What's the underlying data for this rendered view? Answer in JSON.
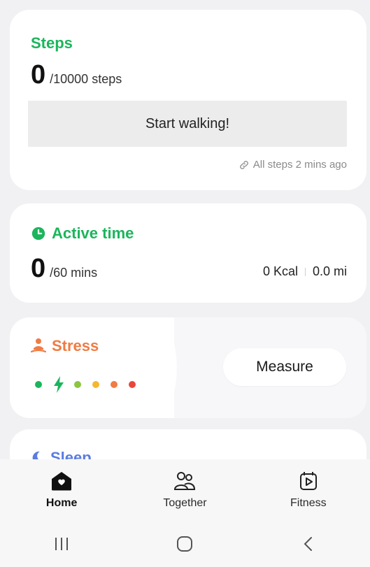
{
  "steps": {
    "title": "Steps",
    "value": "0",
    "goal": "/10000 steps",
    "button_label": "Start walking!",
    "synced_text": "All steps 2 mins ago"
  },
  "active_time": {
    "title": "Active time",
    "value": "0",
    "goal": "/60 mins",
    "kcal": "0 Kcal",
    "distance": "0.0 mi"
  },
  "stress": {
    "title": "Stress",
    "measure_label": "Measure",
    "level_colors": [
      "#1bb55c",
      "#1bb55c",
      "#8cc63f",
      "#f5b731",
      "#f07b43",
      "#e8473a"
    ]
  },
  "sleep": {
    "title": "Sleep"
  },
  "bottom_nav": {
    "items": [
      {
        "label": "Home",
        "icon": "home-icon",
        "active": true
      },
      {
        "label": "Together",
        "icon": "people-icon",
        "active": false
      },
      {
        "label": "Fitness",
        "icon": "fitness-icon",
        "active": false
      }
    ]
  },
  "colors": {
    "green": "#1bb55c",
    "orange": "#f07b43",
    "sleep_blue": "#5b7ce0"
  }
}
